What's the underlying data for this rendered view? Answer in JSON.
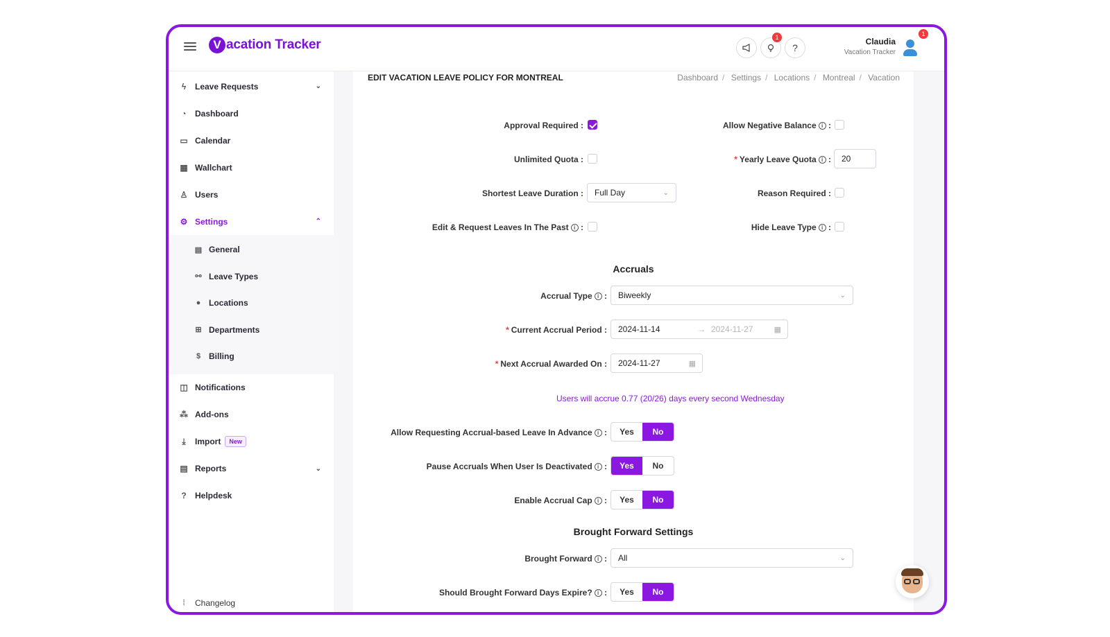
{
  "app": {
    "logo_letter": "V",
    "logo_text": "acation Tracker",
    "brand_color": "#8a18e0"
  },
  "header": {
    "announce_icon": "megaphone-icon",
    "ideas_icon": "lightbulb-icon",
    "ideas_badge": "1",
    "help_icon": "?",
    "user_name": "Claudia",
    "user_org": "Vacation Tracker",
    "user_badge": "1"
  },
  "sidebar": {
    "items": [
      {
        "label": "Leave Requests",
        "icon": "bolt-icon"
      },
      {
        "label": "Dashboard",
        "icon": "dashboard-icon"
      },
      {
        "label": "Calendar",
        "icon": "calendar-icon"
      },
      {
        "label": "Wallchart",
        "icon": "grid-icon"
      },
      {
        "label": "Users",
        "icon": "user-icon"
      },
      {
        "label": "Settings",
        "icon": "gear-icon"
      },
      {
        "label": "Notifications",
        "icon": "bell-icon"
      },
      {
        "label": "Add-ons",
        "icon": "addons-icon"
      },
      {
        "label": "Import",
        "icon": "import-icon",
        "badge": "New"
      },
      {
        "label": "Reports",
        "icon": "report-icon"
      },
      {
        "label": "Helpdesk",
        "icon": "help-icon"
      }
    ],
    "settings_sub": [
      {
        "label": "General",
        "icon": "document-icon"
      },
      {
        "label": "Leave Types",
        "icon": "leave-types-icon"
      },
      {
        "label": "Locations",
        "icon": "location-pin-icon"
      },
      {
        "label": "Departments",
        "icon": "departments-icon"
      },
      {
        "label": "Billing",
        "icon": "dollar-icon"
      }
    ],
    "changelog": "Changelog"
  },
  "page": {
    "title": "EDIT VACATION LEAVE POLICY FOR MONTREAL",
    "breadcrumbs": [
      "Dashboard",
      "Settings",
      "Locations",
      "Montreal",
      "Vacation"
    ]
  },
  "form": {
    "approval_required": {
      "label": "Approval Required",
      "checked": true
    },
    "allow_negative_balance": {
      "label": "Allow Negative Balance",
      "checked": false
    },
    "unlimited_quota": {
      "label": "Unlimited Quota",
      "checked": false
    },
    "yearly_leave_quota": {
      "label": "Yearly Leave Quota",
      "value": "20"
    },
    "shortest_leave_duration": {
      "label": "Shortest Leave Duration",
      "value": "Full Day"
    },
    "reason_required": {
      "label": "Reason Required",
      "checked": false
    },
    "edit_past": {
      "label": "Edit & Request Leaves In The Past",
      "checked": false
    },
    "hide_leave_type": {
      "label": "Hide Leave Type",
      "checked": false
    }
  },
  "accruals": {
    "heading": "Accruals",
    "accrual_type": {
      "label": "Accrual Type",
      "value": "Biweekly"
    },
    "current_period": {
      "label": "Current Accrual Period",
      "start": "2024-11-14",
      "end": "2024-11-27"
    },
    "next_awarded": {
      "label": "Next Accrual Awarded On",
      "value": "2024-11-27"
    },
    "note": "Users will accrue 0.77 (20/26) days every second Wednesday",
    "allow_in_advance": {
      "label": "Allow Requesting Accrual-based Leave In Advance",
      "value": "No"
    },
    "pause_deactivated": {
      "label": "Pause Accruals When User Is Deactivated",
      "value": "Yes"
    },
    "enable_cap": {
      "label": "Enable Accrual Cap",
      "value": "No"
    }
  },
  "brought_forward": {
    "heading": "Brought Forward Settings",
    "brought_forward": {
      "label": "Brought Forward",
      "value": "All"
    },
    "expire": {
      "label": "Should Brought Forward Days Expire?",
      "value": "No"
    }
  },
  "toggle_labels": {
    "yes": "Yes",
    "no": "No"
  }
}
